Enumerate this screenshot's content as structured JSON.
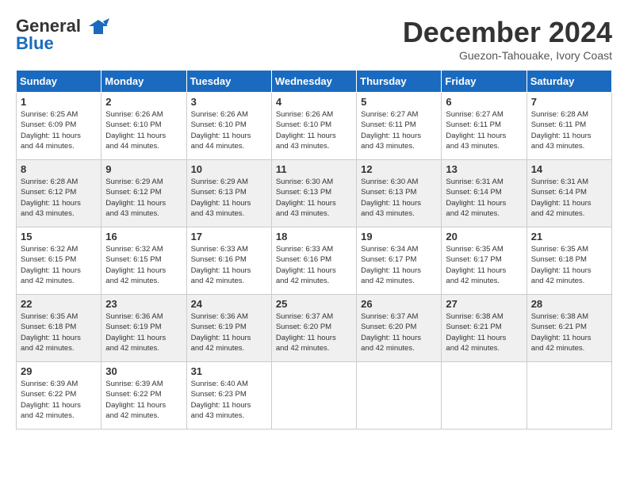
{
  "logo": {
    "line1": "General",
    "line2": "Blue"
  },
  "title": "December 2024",
  "subtitle": "Guezon-Tahouake, Ivory Coast",
  "days_header": [
    "Sunday",
    "Monday",
    "Tuesday",
    "Wednesday",
    "Thursday",
    "Friday",
    "Saturday"
  ],
  "weeks": [
    [
      {
        "day": "1",
        "info": "Sunrise: 6:25 AM\nSunset: 6:09 PM\nDaylight: 11 hours\nand 44 minutes."
      },
      {
        "day": "2",
        "info": "Sunrise: 6:26 AM\nSunset: 6:10 PM\nDaylight: 11 hours\nand 44 minutes."
      },
      {
        "day": "3",
        "info": "Sunrise: 6:26 AM\nSunset: 6:10 PM\nDaylight: 11 hours\nand 44 minutes."
      },
      {
        "day": "4",
        "info": "Sunrise: 6:26 AM\nSunset: 6:10 PM\nDaylight: 11 hours\nand 43 minutes."
      },
      {
        "day": "5",
        "info": "Sunrise: 6:27 AM\nSunset: 6:11 PM\nDaylight: 11 hours\nand 43 minutes."
      },
      {
        "day": "6",
        "info": "Sunrise: 6:27 AM\nSunset: 6:11 PM\nDaylight: 11 hours\nand 43 minutes."
      },
      {
        "day": "7",
        "info": "Sunrise: 6:28 AM\nSunset: 6:11 PM\nDaylight: 11 hours\nand 43 minutes."
      }
    ],
    [
      {
        "day": "8",
        "info": "Sunrise: 6:28 AM\nSunset: 6:12 PM\nDaylight: 11 hours\nand 43 minutes."
      },
      {
        "day": "9",
        "info": "Sunrise: 6:29 AM\nSunset: 6:12 PM\nDaylight: 11 hours\nand 43 minutes."
      },
      {
        "day": "10",
        "info": "Sunrise: 6:29 AM\nSunset: 6:13 PM\nDaylight: 11 hours\nand 43 minutes."
      },
      {
        "day": "11",
        "info": "Sunrise: 6:30 AM\nSunset: 6:13 PM\nDaylight: 11 hours\nand 43 minutes."
      },
      {
        "day": "12",
        "info": "Sunrise: 6:30 AM\nSunset: 6:13 PM\nDaylight: 11 hours\nand 43 minutes."
      },
      {
        "day": "13",
        "info": "Sunrise: 6:31 AM\nSunset: 6:14 PM\nDaylight: 11 hours\nand 42 minutes."
      },
      {
        "day": "14",
        "info": "Sunrise: 6:31 AM\nSunset: 6:14 PM\nDaylight: 11 hours\nand 42 minutes."
      }
    ],
    [
      {
        "day": "15",
        "info": "Sunrise: 6:32 AM\nSunset: 6:15 PM\nDaylight: 11 hours\nand 42 minutes."
      },
      {
        "day": "16",
        "info": "Sunrise: 6:32 AM\nSunset: 6:15 PM\nDaylight: 11 hours\nand 42 minutes."
      },
      {
        "day": "17",
        "info": "Sunrise: 6:33 AM\nSunset: 6:16 PM\nDaylight: 11 hours\nand 42 minutes."
      },
      {
        "day": "18",
        "info": "Sunrise: 6:33 AM\nSunset: 6:16 PM\nDaylight: 11 hours\nand 42 minutes."
      },
      {
        "day": "19",
        "info": "Sunrise: 6:34 AM\nSunset: 6:17 PM\nDaylight: 11 hours\nand 42 minutes."
      },
      {
        "day": "20",
        "info": "Sunrise: 6:35 AM\nSunset: 6:17 PM\nDaylight: 11 hours\nand 42 minutes."
      },
      {
        "day": "21",
        "info": "Sunrise: 6:35 AM\nSunset: 6:18 PM\nDaylight: 11 hours\nand 42 minutes."
      }
    ],
    [
      {
        "day": "22",
        "info": "Sunrise: 6:35 AM\nSunset: 6:18 PM\nDaylight: 11 hours\nand 42 minutes."
      },
      {
        "day": "23",
        "info": "Sunrise: 6:36 AM\nSunset: 6:19 PM\nDaylight: 11 hours\nand 42 minutes."
      },
      {
        "day": "24",
        "info": "Sunrise: 6:36 AM\nSunset: 6:19 PM\nDaylight: 11 hours\nand 42 minutes."
      },
      {
        "day": "25",
        "info": "Sunrise: 6:37 AM\nSunset: 6:20 PM\nDaylight: 11 hours\nand 42 minutes."
      },
      {
        "day": "26",
        "info": "Sunrise: 6:37 AM\nSunset: 6:20 PM\nDaylight: 11 hours\nand 42 minutes."
      },
      {
        "day": "27",
        "info": "Sunrise: 6:38 AM\nSunset: 6:21 PM\nDaylight: 11 hours\nand 42 minutes."
      },
      {
        "day": "28",
        "info": "Sunrise: 6:38 AM\nSunset: 6:21 PM\nDaylight: 11 hours\nand 42 minutes."
      }
    ],
    [
      {
        "day": "29",
        "info": "Sunrise: 6:39 AM\nSunset: 6:22 PM\nDaylight: 11 hours\nand 42 minutes."
      },
      {
        "day": "30",
        "info": "Sunrise: 6:39 AM\nSunset: 6:22 PM\nDaylight: 11 hours\nand 42 minutes."
      },
      {
        "day": "31",
        "info": "Sunrise: 6:40 AM\nSunset: 6:23 PM\nDaylight: 11 hours\nand 43 minutes."
      },
      {
        "day": "",
        "info": ""
      },
      {
        "day": "",
        "info": ""
      },
      {
        "day": "",
        "info": ""
      },
      {
        "day": "",
        "info": ""
      }
    ]
  ]
}
